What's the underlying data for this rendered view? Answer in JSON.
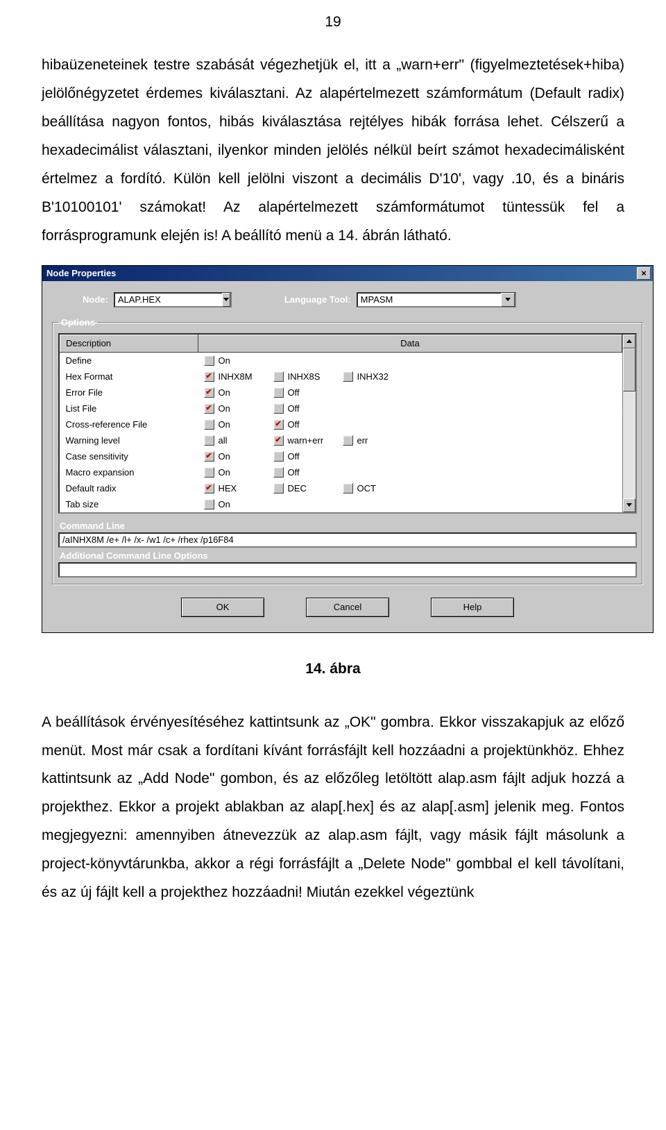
{
  "page_number": "19",
  "para1": "hibaüzeneteinek testre szabását végezhetjük el, itt a „warn+err\" (figyelmeztetések+hiba) jelölőnégyzetet érdemes kiválasztani. Az alapértelmezett számformátum (Default radix) beállítása nagyon fontos, hibás kiválasztása rejtélyes hibák forrása lehet. Célszerű a hexadecimálist választani, ilyenkor minden jelölés nélkül beírt számot hexadecimálisként értelmez a fordító. Külön kell jelölni viszont a decimális D'10', vagy .10, és a bináris B'10100101' számokat! Az alapértelmezett számformátumot tüntessük fel a forrásprogramunk elején is! A beállító menü a 14. ábrán látható.",
  "figure_caption": "14. ábra",
  "para2": "A beállítások érvényesítéséhez kattintsunk az „OK\" gombra. Ekkor visszakapjuk az előző menüt. Most már csak a fordítani kívánt forrásfájlt kell hozzáadni a projektünkhöz. Ehhez kattintsunk az „Add Node\" gombon, és az előzőleg letöltött alap.asm fájlt adjuk hozzá a projekthez. Ekkor a projekt ablakban az alap[.hex] és az alap[.asm] jelenik meg. Fontos megjegyezni: amennyiben átnevezzük az alap.asm fájlt, vagy másik fájlt másolunk a project-könyvtárunkba, akkor a régi forrásfájlt a „Delete Node\" gombbal el kell távolítani, és az új fájlt kell a projekthez hozzáadni! Miután ezekkel végeztünk",
  "dialog": {
    "title": "Node Properties",
    "close": "×",
    "node_label": "Node:",
    "node_value": "ALAP.HEX",
    "lang_label": "Language Tool:",
    "lang_value": "MPASM",
    "options_legend": "Options",
    "col_desc": "Description",
    "col_data": "Data",
    "rows": [
      {
        "desc": "Define",
        "opts": [
          {
            "label": "On",
            "checked": false
          }
        ]
      },
      {
        "desc": "Hex Format",
        "opts": [
          {
            "label": "INHX8M",
            "checked": true
          },
          {
            "label": "INHX8S",
            "checked": false
          },
          {
            "label": "INHX32",
            "checked": false
          }
        ]
      },
      {
        "desc": "Error File",
        "opts": [
          {
            "label": "On",
            "checked": true
          },
          {
            "label": "Off",
            "checked": false
          }
        ]
      },
      {
        "desc": "List File",
        "opts": [
          {
            "label": "On",
            "checked": true
          },
          {
            "label": "Off",
            "checked": false
          }
        ]
      },
      {
        "desc": "Cross-reference File",
        "opts": [
          {
            "label": "On",
            "checked": false
          },
          {
            "label": "Off",
            "checked": true
          }
        ]
      },
      {
        "desc": "Warning level",
        "opts": [
          {
            "label": "all",
            "checked": false
          },
          {
            "label": "warn+err",
            "checked": true
          },
          {
            "label": "err",
            "checked": false
          }
        ]
      },
      {
        "desc": "Case sensitivity",
        "opts": [
          {
            "label": "On",
            "checked": true
          },
          {
            "label": "Off",
            "checked": false
          }
        ]
      },
      {
        "desc": "Macro expansion",
        "opts": [
          {
            "label": "On",
            "checked": false
          },
          {
            "label": "Off",
            "checked": false
          }
        ]
      },
      {
        "desc": "Default radix",
        "opts": [
          {
            "label": "HEX",
            "checked": true
          },
          {
            "label": "DEC",
            "checked": false
          },
          {
            "label": "OCT",
            "checked": false
          }
        ]
      },
      {
        "desc": "Tab size",
        "opts": [
          {
            "label": "On",
            "checked": false
          }
        ]
      }
    ],
    "cmd_label": "Command Line",
    "cmd_value": "/aINHX8M /e+ /l+ /x- /w1 /c+ /rhex /p16F84",
    "addl_label": "Additional Command Line Options",
    "addl_value": "",
    "btn_ok": "OK",
    "btn_cancel": "Cancel",
    "btn_help": "Help"
  }
}
